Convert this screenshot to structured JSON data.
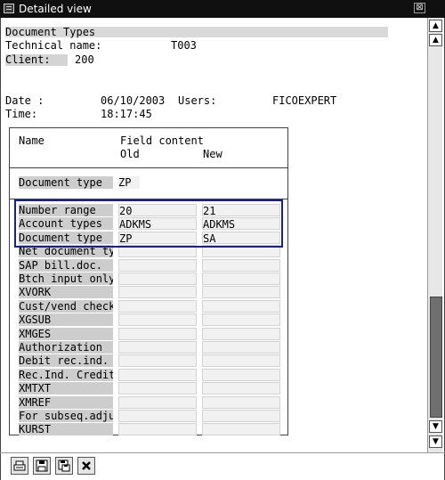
{
  "window": {
    "title": "Detailed view",
    "close_glyph": "⊠"
  },
  "header": {
    "heading": "Document Types",
    "technical_label": "Technical name:",
    "technical_value": "T003",
    "client_label": "Client:",
    "client_value": "200",
    "date_label": "Date :",
    "date_value": "06/10/2003",
    "users_label": "Users:",
    "users_value": "FICOEXPERT",
    "time_label": "Time:",
    "time_value": "18:17:45"
  },
  "table": {
    "col_name": "Name",
    "col_field": "Field content",
    "col_old": "Old",
    "col_new": "New",
    "key_row": {
      "name": "Document type",
      "value": "ZP"
    },
    "rows": [
      {
        "name": "Number range",
        "old": "20",
        "new": "21"
      },
      {
        "name": "Account types",
        "old": "ADKMS",
        "new": "ADKMS"
      },
      {
        "name": "Document type",
        "old": "ZP",
        "new": "SA"
      },
      {
        "name": "Net document ty",
        "old": "",
        "new": ""
      },
      {
        "name": "SAP bill.doc.",
        "old": "",
        "new": ""
      },
      {
        "name": "Btch input only",
        "old": "",
        "new": ""
      },
      {
        "name": "XVORK",
        "old": "",
        "new": ""
      },
      {
        "name": "Cust/vend check",
        "old": "",
        "new": ""
      },
      {
        "name": "XGSUB",
        "old": "",
        "new": ""
      },
      {
        "name": "XMGES",
        "old": "",
        "new": ""
      },
      {
        "name": "Authorization",
        "old": "",
        "new": ""
      },
      {
        "name": "Debit rec.ind.",
        "old": "",
        "new": ""
      },
      {
        "name": "Rec.Ind. Credit",
        "old": "",
        "new": ""
      },
      {
        "name": "XMTXT",
        "old": "",
        "new": ""
      },
      {
        "name": "XMREF",
        "old": "",
        "new": ""
      },
      {
        "name": "For subseq.adju",
        "old": "",
        "new": ""
      },
      {
        "name": "KURST",
        "old": "",
        "new": ""
      }
    ]
  },
  "scrollbar": {
    "up_glyph": "▲",
    "down_glyph": "▼"
  },
  "toolbar": [
    "print-icon",
    "save-icon",
    "save-as-icon",
    "cancel-icon"
  ]
}
